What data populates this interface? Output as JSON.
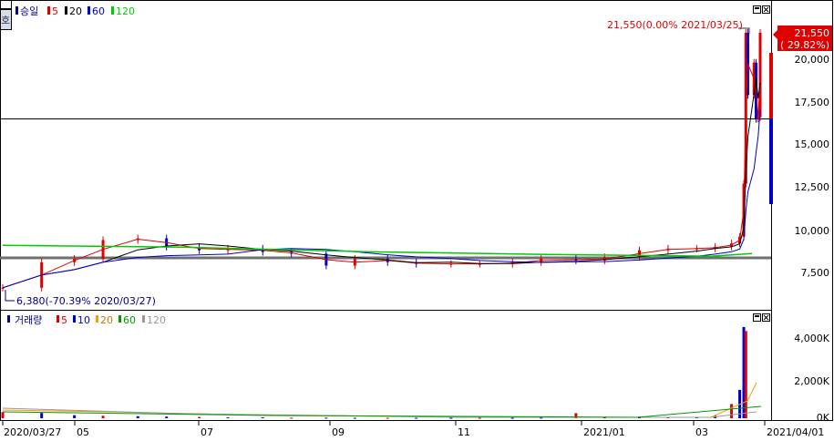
{
  "price_panel": {
    "legend": {
      "name": "승일",
      "ma": [
        "5",
        "20",
        "60",
        "120"
      ]
    },
    "max_annotation": "21,550(0.00% 2021/03/25)",
    "min_annotation": "6,380(-70.39% 2020/03/27)",
    "last_price_tag": {
      "price": "21,550",
      "change": "( 29.82%)"
    },
    "y_tick_labels": [
      "20,000",
      "17,500",
      "15,000",
      "12,500",
      "10,000",
      "7,500"
    ]
  },
  "volume_panel": {
    "legend": {
      "name": "거래량",
      "ma": [
        "5",
        "10",
        "20",
        "60",
        "120"
      ]
    },
    "y_tick_labels": [
      "4,000K",
      "2,000K",
      "0K"
    ]
  },
  "x_axis": {
    "labels": [
      "2020/03/27",
      "05",
      "07",
      "09",
      "11",
      "2021/01",
      "03",
      "2021/04/01"
    ]
  },
  "colors": {
    "up": "#e00000",
    "down": "#0000cc",
    "ma5": "#e00000",
    "ma20": "#000000",
    "ma60": "#0000cc",
    "ma120": "#00cc00",
    "ref_line": "#707070",
    "vol_ma10": "#0000cc",
    "vol_ma20": "#ff9900",
    "vol_ma60": "#009900",
    "vol_ma120": "#999999"
  },
  "chart_data": [
    {
      "type": "candlestick",
      "y_ticks": [
        7500,
        10000,
        12500,
        15000,
        17500,
        20000
      ],
      "ylim": [
        5800,
        23000
      ],
      "x": [
        "2020-03-27",
        "2020-04-15",
        "2020-05-01",
        "2020-05-15",
        "2020-06-01",
        "2020-06-15",
        "2020-07-01",
        "2020-07-15",
        "2020-08-01",
        "2020-08-15",
        "2020-09-01",
        "2020-09-15",
        "2020-10-01",
        "2020-10-15",
        "2020-11-01",
        "2020-11-15",
        "2020-12-01",
        "2020-12-15",
        "2021-01-01",
        "2021-01-15",
        "2021-02-01",
        "2021-02-15",
        "2021-03-01",
        "2021-03-10",
        "2021-03-18",
        "2021-03-22",
        "2021-03-24",
        "2021-03-25",
        "2021-03-26",
        "2021-03-29",
        "2021-03-30",
        "2021-03-31",
        "2021-04-01"
      ],
      "close": [
        6600,
        8100,
        8300,
        9400,
        9500,
        9000,
        8800,
        8900,
        8700,
        8600,
        7900,
        8300,
        8100,
        8000,
        8000,
        8000,
        8100,
        8300,
        8200,
        8400,
        8800,
        8900,
        8900,
        9000,
        9200,
        9600,
        12700,
        21550,
        17900,
        19800,
        16500,
        16600,
        21550
      ],
      "ma120_level": 8450
    },
    {
      "type": "bar",
      "y_ticks": [
        0,
        2000,
        4000
      ],
      "ylim": [
        0,
        4900
      ],
      "values_K": [
        300,
        260,
        150,
        120,
        100,
        80,
        60,
        40,
        40,
        30,
        30,
        20,
        20,
        20,
        20,
        20,
        20,
        30,
        250,
        40,
        80,
        60,
        60,
        120,
        700,
        1400,
        4500,
        4300
      ]
    }
  ]
}
